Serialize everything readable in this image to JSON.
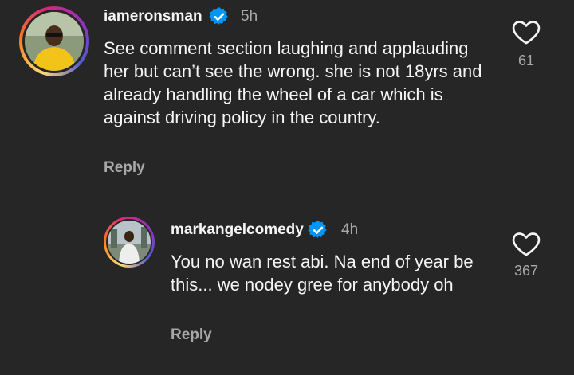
{
  "comments": [
    {
      "username": "iameronsman",
      "time": "5h",
      "text": "See comment section laughing and applauding her but can’t see the wrong. she is not 18yrs and already handling the wheel of a car which is against driving policy in the country.",
      "reply_label": "Reply",
      "likes": "61",
      "avatar_icon": "user-avatar"
    },
    {
      "username": "markangelcomedy",
      "time": "4h",
      "text": "You no wan rest abi. Na end of year be this... we nodey gree for anybody oh",
      "reply_label": "Reply",
      "likes": "367",
      "avatar_icon": "user-avatar"
    }
  ],
  "colors": {
    "background": "#262626",
    "verified": "#0095f6",
    "muted": "#a8a8a8",
    "text": "#f5f5f5"
  }
}
